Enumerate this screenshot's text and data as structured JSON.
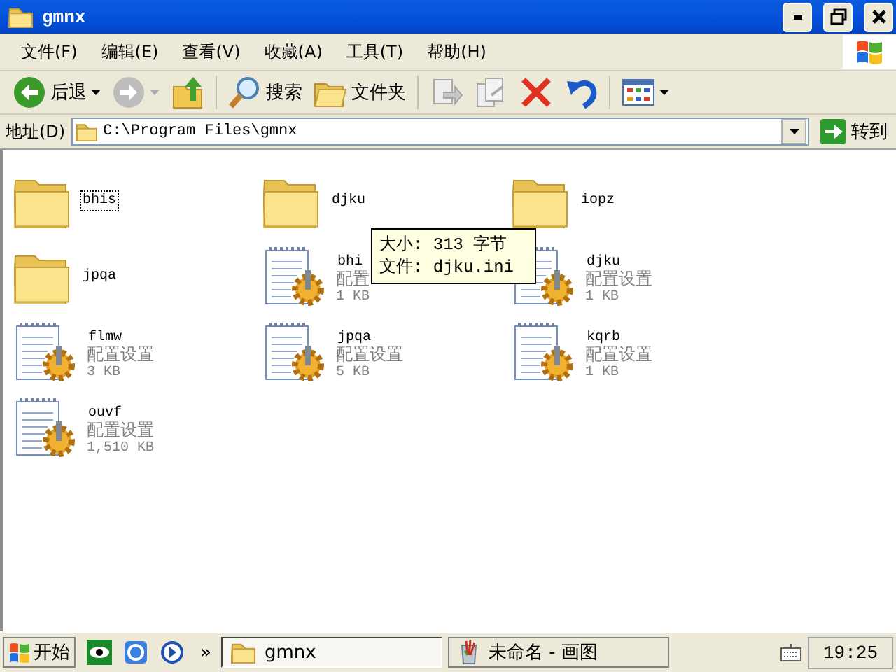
{
  "window": {
    "title": "gmnx"
  },
  "menu": [
    {
      "label": "文件(F)"
    },
    {
      "label": "编辑(E)"
    },
    {
      "label": "查看(V)"
    },
    {
      "label": "收藏(A)"
    },
    {
      "label": "工具(T)"
    },
    {
      "label": "帮助(H)"
    }
  ],
  "toolbar": [
    {
      "kind": "back",
      "label": "后退",
      "disabled": false,
      "dropdown": true
    },
    {
      "kind": "forward",
      "disabled": true,
      "dropdown": true
    },
    {
      "kind": "up",
      "disabled": false
    },
    {
      "kind": "separator"
    },
    {
      "kind": "search",
      "label": "搜索",
      "disabled": false
    },
    {
      "kind": "folders",
      "label": "文件夹",
      "disabled": false
    },
    {
      "kind": "separator"
    },
    {
      "kind": "move",
      "disabled": true
    },
    {
      "kind": "copy",
      "disabled": true
    },
    {
      "kind": "delete",
      "disabled": false
    },
    {
      "kind": "undo",
      "disabled": false
    },
    {
      "kind": "separator"
    },
    {
      "kind": "views",
      "disabled": false,
      "dropdown": true
    }
  ],
  "address": {
    "label": "地址(D)",
    "value": "C:\\Program Files\\gmnx",
    "go": "转到"
  },
  "items": [
    {
      "kind": "folder",
      "name": "bhis",
      "focused": true
    },
    {
      "kind": "folder",
      "name": "djku",
      "focused": false
    },
    {
      "kind": "folder",
      "name": "iopz",
      "focused": false
    },
    {
      "kind": "folder",
      "name": "jpqa",
      "focused": false
    },
    {
      "kind": "config",
      "name": "bhi",
      "type": "配置",
      "size": "1 KB",
      "focused": false
    },
    {
      "kind": "config",
      "name": "djku",
      "type": "配置设置",
      "size": "1 KB",
      "focused": false
    },
    {
      "kind": "config",
      "name": "flmw",
      "type": "配置设置",
      "size": "3 KB",
      "focused": false
    },
    {
      "kind": "config",
      "name": "jpqa",
      "type": "配置设置",
      "size": "5 KB",
      "focused": false
    },
    {
      "kind": "config",
      "name": "kqrb",
      "type": "配置设置",
      "size": "1 KB",
      "focused": false
    },
    {
      "kind": "config",
      "name": "ouvf",
      "type": "配置设置",
      "size": "1,510 KB",
      "focused": false
    }
  ],
  "tooltip": {
    "lines": [
      "大小: 313 字节",
      "文件: djku.ini"
    ]
  },
  "taskbar": {
    "start": "开始",
    "quick_launch": [
      {
        "kind": "eye"
      },
      {
        "kind": "ie"
      },
      {
        "kind": "media"
      }
    ],
    "chevron": "»",
    "tasks": [
      {
        "kind": "folder",
        "label": "gmnx",
        "selected": true
      },
      {
        "kind": "paint",
        "label": "未命名 - 画图",
        "selected": false
      }
    ],
    "clock": "19:25"
  }
}
